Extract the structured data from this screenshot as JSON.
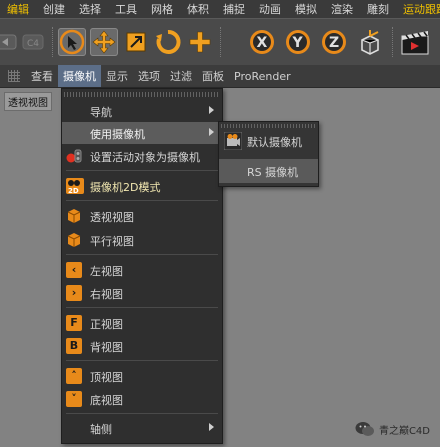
{
  "menubar": {
    "items": [
      "编辑",
      "创建",
      "选择",
      "工具",
      "网格",
      "体积",
      "捕捉",
      "动画",
      "模拟",
      "渲染",
      "雕刻",
      "运动跟踪"
    ]
  },
  "toolbar": {
    "buttons": [
      "undo",
      "redo",
      "live-select",
      "move",
      "scale",
      "rotate",
      "recent-tools",
      "x-axis",
      "y-axis",
      "z-axis",
      "coordinate-system",
      "render-view"
    ]
  },
  "viewbar": {
    "items": [
      "查看",
      "摄像机",
      "显示",
      "选项",
      "过滤",
      "面板",
      "ProRender"
    ],
    "active_index": 1
  },
  "viewport": {
    "label": "透视视图"
  },
  "camera_menu": {
    "items": [
      {
        "label": "导航",
        "icon": "none",
        "submenu": true
      },
      {
        "label": "使用摄像机",
        "icon": "none",
        "submenu": true,
        "hover": true
      },
      {
        "label": "设置活动对象为摄像机",
        "icon": "camera-set-icon"
      },
      {
        "label": "摄像机2D模式",
        "icon": "camera-2d-icon"
      },
      {
        "label": "透视视图",
        "icon": "perspective-cube-icon"
      },
      {
        "label": "平行视图",
        "icon": "parallel-cube-icon"
      },
      {
        "label": "左视图",
        "icon": "left-view-icon",
        "glyph": "‹"
      },
      {
        "label": "右视图",
        "icon": "right-view-icon",
        "glyph": "›"
      },
      {
        "label": "正视图",
        "icon": "front-view-icon",
        "glyph": "F"
      },
      {
        "label": "背视图",
        "icon": "back-view-icon",
        "glyph": "B"
      },
      {
        "label": "顶视图",
        "icon": "top-view-icon",
        "glyph": "˄"
      },
      {
        "label": "底视图",
        "icon": "bottom-view-icon",
        "glyph": "˅"
      },
      {
        "label": "轴侧",
        "icon": "none",
        "submenu": true
      }
    ]
  },
  "use_camera_submenu": {
    "items": [
      "默认摄像机",
      "RS 摄像机"
    ]
  },
  "watermark": {
    "text": "青之巅C4D"
  }
}
